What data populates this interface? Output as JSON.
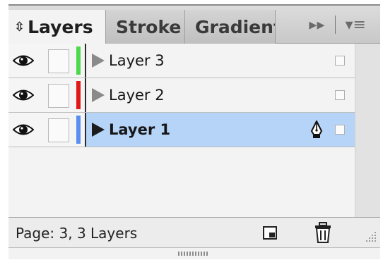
{
  "tabs": [
    {
      "label": "Layers",
      "active": true
    },
    {
      "label": "Stroke",
      "active": false
    },
    {
      "label": "Gradient",
      "active": false
    }
  ],
  "tab_overflow_icon": "double-chevron-right-icon",
  "panel_menu_icon": "panel-menu-icon",
  "layers": [
    {
      "name": "Layer 3",
      "color": "#4cd84c",
      "visible": true,
      "selected": false
    },
    {
      "name": "Layer 2",
      "color": "#e01818",
      "visible": true,
      "selected": false
    },
    {
      "name": "Layer 1",
      "color": "#5a8ef0",
      "visible": true,
      "selected": true
    }
  ],
  "footer": {
    "status": "Page: 3, 3 Layers",
    "new_layer_icon": "new-layer-icon",
    "delete_icon": "trash-icon"
  },
  "colors": {
    "selection": "#b6d4f7",
    "panel_bg": "#f3f3f3",
    "tab_bg": "#c8c8c8"
  }
}
